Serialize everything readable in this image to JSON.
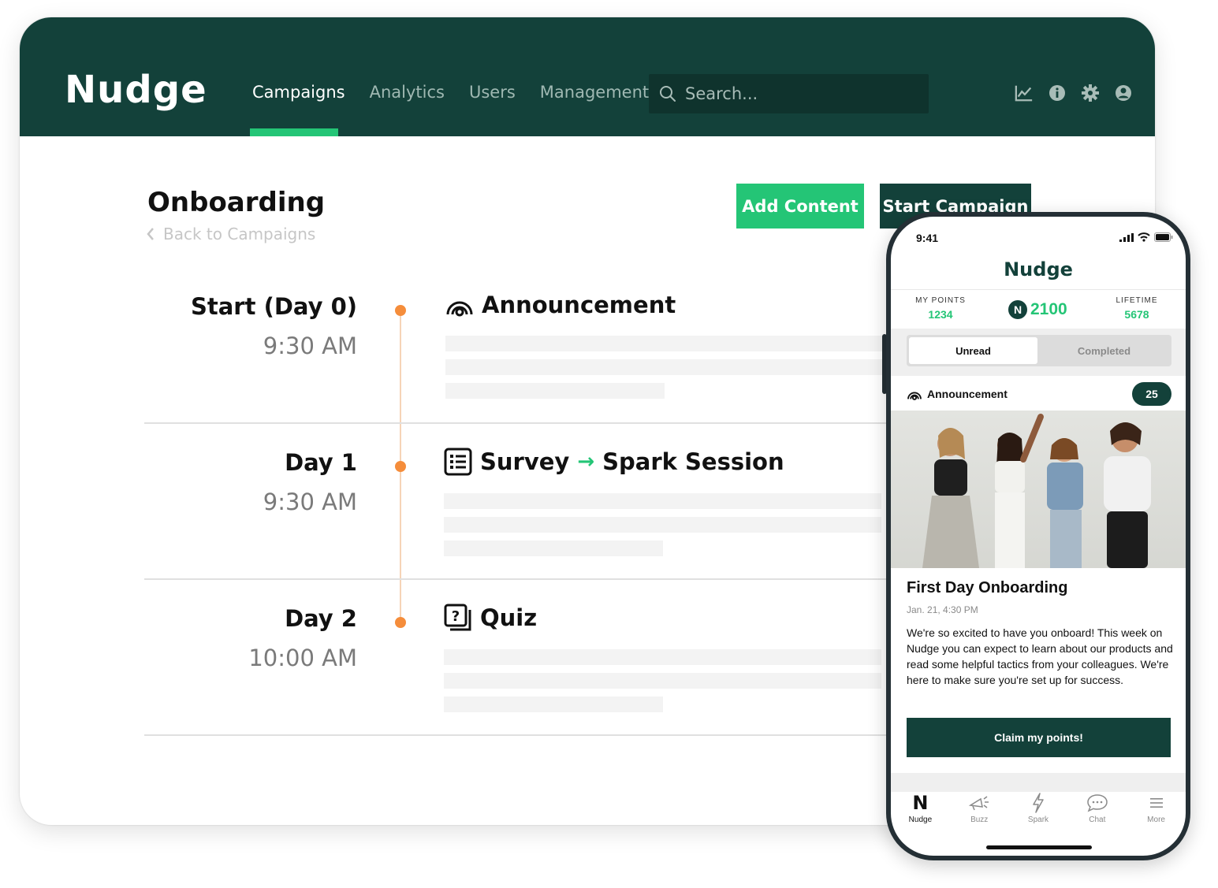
{
  "app": {
    "logo": "Nudge",
    "nav": [
      "Campaigns",
      "Analytics",
      "Users",
      "Management"
    ],
    "search_placeholder": "Search..."
  },
  "page": {
    "title": "Onboarding",
    "back_label": "Back to Campaigns",
    "add_button": "Add Content",
    "start_button": "Start Campaign"
  },
  "timeline": [
    {
      "day": "Start (Day 0)",
      "time": "9:30 AM",
      "icon": "announcement-icon",
      "title": "Announcement",
      "next": ""
    },
    {
      "day": "Day 1",
      "time": "9:30 AM",
      "icon": "survey-icon",
      "title": "Survey",
      "next": "Spark Session"
    },
    {
      "day": "Day 2",
      "time": "10:00 AM",
      "icon": "quiz-icon",
      "title": "Quiz",
      "next": ""
    }
  ],
  "phone": {
    "time": "9:41",
    "logo": "Nudge",
    "my_points_label": "MY POINTS",
    "my_points": "1234",
    "total_points": "2100",
    "lifetime_label": "LIFETIME",
    "lifetime": "5678",
    "tabs": {
      "unread": "Unread",
      "completed": "Completed"
    },
    "card": {
      "type": "Announcement",
      "count": "25",
      "title": "First Day Onboarding",
      "date": "Jan. 21, 4:30 PM",
      "body": "We're so excited to have you onboard! This week on Nudge you can expect to learn about our products and read some helpful tactics from your colleagues. We're here to make sure you're set up for success.",
      "cta": "Claim my points!"
    },
    "tabbar": [
      "Nudge",
      "Buzz",
      "Spark",
      "Chat",
      "More"
    ]
  },
  "colors": {
    "brand_dark": "#13413a",
    "brand_green": "#24c576",
    "timeline_dot": "#f58d3b"
  }
}
